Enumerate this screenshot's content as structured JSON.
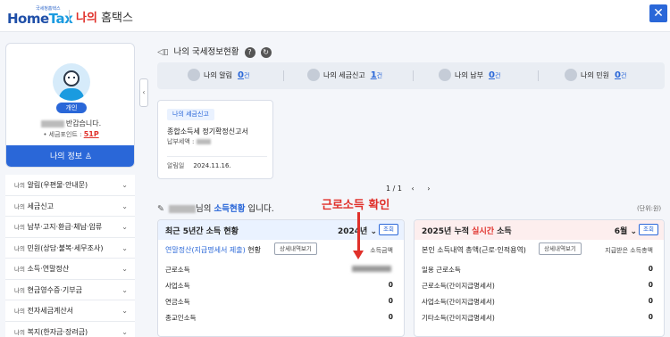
{
  "header": {
    "logo_small": "국세청홈택스",
    "logo_main_a": "Home",
    "logo_main_b": "Tax",
    "title_red": "나의",
    "title_dark": "홈택스",
    "close_icon": "close-icon"
  },
  "profile": {
    "badge": "개인",
    "greeting_suffix": "반갑습니다.",
    "points_label": "• 세금포인트 :",
    "points_value": "51P",
    "my_info_button": "나의 정보"
  },
  "menu": {
    "items": [
      {
        "pre": "나의",
        "label": "알림(우편물·안내문)"
      },
      {
        "pre": "나의",
        "label": "세금신고"
      },
      {
        "pre": "나의",
        "label": "납부·고지·환급·체납·압류"
      },
      {
        "pre": "나의",
        "label": "민원(상담·불복·세무조사)"
      },
      {
        "pre": "나의",
        "label": "소득·연말정산"
      },
      {
        "pre": "나의",
        "label": "현금영수증·기부금"
      },
      {
        "pre": "나의",
        "label": "전자세금계산서"
      },
      {
        "pre": "나의",
        "label": "복지(한자금·장려금)"
      }
    ]
  },
  "status_section": {
    "title": "나의 국세정보현황",
    "stats": [
      {
        "label": "나의 알림",
        "count": "0",
        "unit": "건"
      },
      {
        "label": "나의 세금신고",
        "count": "1",
        "unit": "건"
      },
      {
        "label": "나의 납부",
        "count": "0",
        "unit": "건"
      },
      {
        "label": "나의 민원",
        "count": "0",
        "unit": "건"
      }
    ]
  },
  "filing_card": {
    "tag": "나의 세금신고",
    "name": "종합소득세 정기확정신고서",
    "status_label": "납부세액 :",
    "date_label": "알림일",
    "date_value": "2024.11.16."
  },
  "pager": {
    "text": "1 / 1",
    "arrows": "‹ ›"
  },
  "income": {
    "title_suffix_a": "님의",
    "title_blue": "소득현황",
    "title_suffix_b": "입니다.",
    "annotation": "근로소득 확인",
    "unit_note": "(단위:원)",
    "left_panel": {
      "title": "최근 5년간 소득 현황",
      "year": "2024년",
      "lookup": "조회",
      "sub_blue": "연말정산(지급명세서 제출)",
      "sub_rest": "현황",
      "detail_button": "상세내역보기",
      "col_head": "소득금액",
      "rows": [
        {
          "label": "근로소득",
          "value": ""
        },
        {
          "label": "사업소득",
          "value": "0"
        },
        {
          "label": "연금소득",
          "value": "0"
        },
        {
          "label": "종교인소득",
          "value": "0"
        }
      ]
    },
    "right_panel": {
      "title_a": "2025년 누적",
      "title_red": "실시간",
      "title_b": "소득",
      "month": "6월",
      "lookup": "조회",
      "sub": "본인 소득내역 총액(근로·인적용역)",
      "detail_button": "상세내역보기",
      "col_head": "지급받은 소득총액",
      "rows": [
        {
          "label": "일용 근로소득",
          "value": "0"
        },
        {
          "label": "근로소득(간이지급명세서)",
          "value": "0"
        },
        {
          "label": "사업소득(간이지급명세서)",
          "value": "0"
        },
        {
          "label": "기타소득(간이지급명세서)",
          "value": "0"
        }
      ]
    }
  },
  "colors": {
    "brand_blue": "#2a67d8",
    "accent_red": "#e0302a",
    "panel_blue_bg": "#eaf2ff",
    "panel_red_bg": "#fdeeee"
  }
}
